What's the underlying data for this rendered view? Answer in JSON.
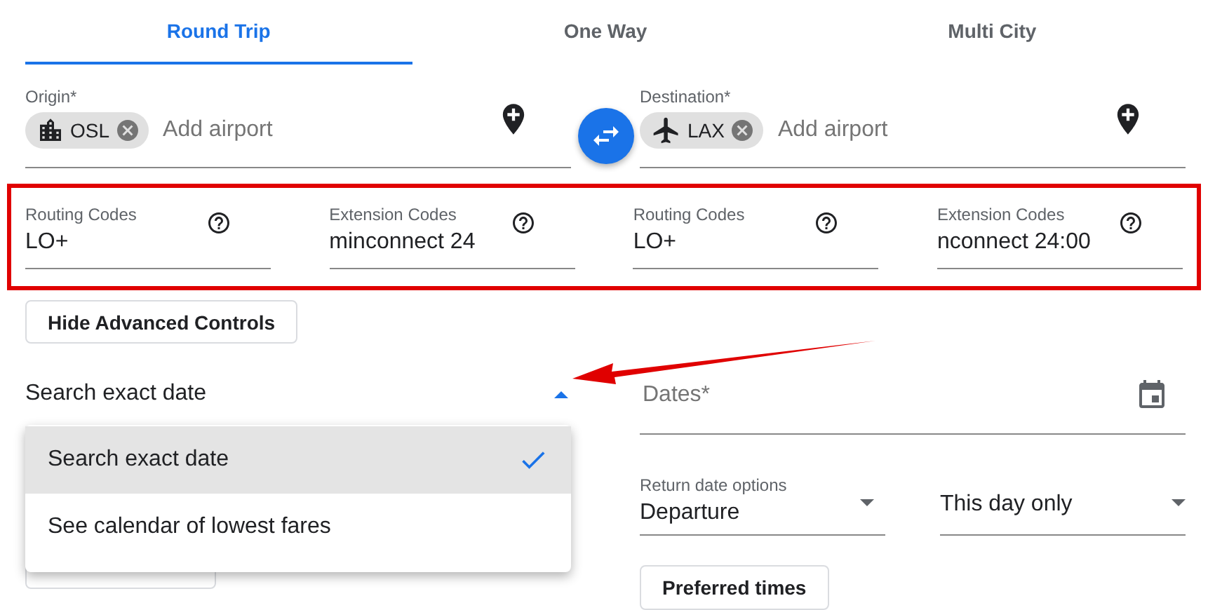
{
  "tabs": [
    {
      "label": "Round Trip",
      "selected": true
    },
    {
      "label": "One Way",
      "selected": false
    },
    {
      "label": "Multi City",
      "selected": false
    }
  ],
  "origin": {
    "label": "Origin*",
    "chips": [
      {
        "code": "OSL",
        "kind": "city"
      }
    ],
    "placeholder": "Add airport"
  },
  "destination": {
    "label": "Destination*",
    "chips": [
      {
        "code": "LAX",
        "kind": "airport"
      }
    ],
    "placeholder": "Add airport"
  },
  "advanced_fields": [
    {
      "label": "Routing Codes",
      "value": "LO+"
    },
    {
      "label": "Extension Codes",
      "value": "minconnect 24"
    },
    {
      "label": "Routing Codes",
      "value": "LO+"
    },
    {
      "label": "Extension Codes",
      "value": "nconnect 24:00"
    }
  ],
  "advanced_toggle": "Hide Advanced Controls",
  "date_mode": {
    "value": "Search exact date",
    "expanded": true,
    "options": [
      {
        "label": "Search exact date",
        "selected": true
      },
      {
        "label": "See calendar of lowest fares",
        "selected": false
      }
    ]
  },
  "dates": {
    "placeholder": "Dates*"
  },
  "return_options": {
    "label": "Return date options",
    "value": "Departure"
  },
  "flexibility": {
    "value": "This day only"
  },
  "preferred_times": "Preferred times"
}
